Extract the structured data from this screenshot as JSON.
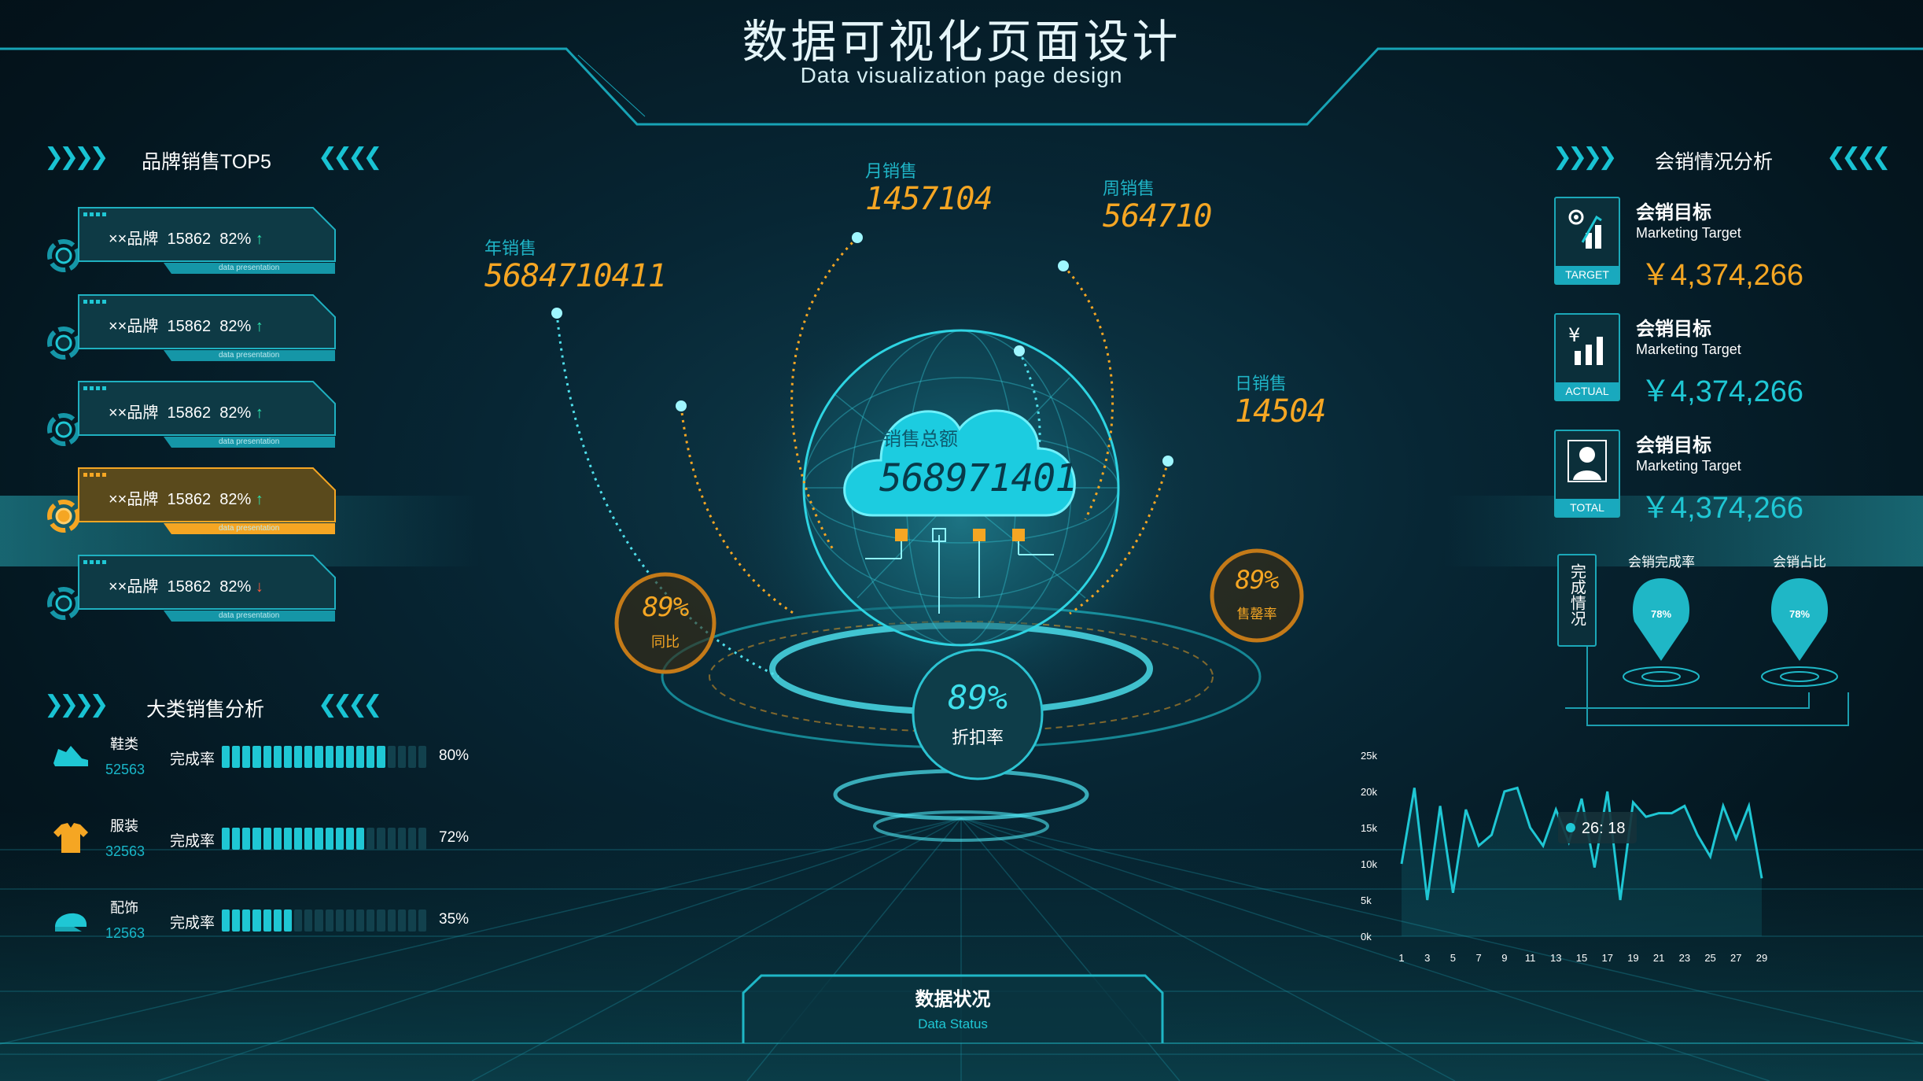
{
  "header": {
    "title": "数据可视化页面设计",
    "subtitle": "Data visualization page design"
  },
  "brand_panel": {
    "title": "品牌销售TOP5",
    "items": [
      {
        "name": "××品牌",
        "value": "15862",
        "pct": "82%",
        "trend": "↑",
        "sub": "data presentation"
      },
      {
        "name": "××品牌",
        "value": "15862",
        "pct": "82%",
        "trend": "↑",
        "sub": "data presentation"
      },
      {
        "name": "××品牌",
        "value": "15862",
        "pct": "82%",
        "trend": "↑",
        "sub": "data presentation"
      },
      {
        "name": "××品牌",
        "value": "15862",
        "pct": "82%",
        "trend": "↑",
        "sub": "data presentation"
      },
      {
        "name": "××品牌",
        "value": "15862",
        "pct": "82%",
        "trend": "↓",
        "sub": "data presentation"
      }
    ]
  },
  "category_panel": {
    "title": "大类销售分析",
    "items": [
      {
        "name": "鞋类",
        "value": "52563",
        "label": "完成率",
        "pct": "80%",
        "fraction": 0.8,
        "icon": "shoe-icon"
      },
      {
        "name": "服装",
        "value": "32563",
        "label": "完成率",
        "pct": "72%",
        "fraction": 0.72,
        "icon": "shirt-icon"
      },
      {
        "name": "配饰",
        "value": "12563",
        "label": "完成率",
        "pct": "35%",
        "fraction": 0.35,
        "icon": "cap-icon"
      }
    ]
  },
  "center": {
    "year_label": "年销售",
    "year_value": "5684710411",
    "month_label": "月销售",
    "month_value": "1457104",
    "week_label": "周销售",
    "week_value": "564710",
    "day_label": "日销售",
    "day_value": "14504",
    "total_label": "销售总额",
    "total_value": "568971401",
    "yoy_value": "89%",
    "yoy_label": "同比",
    "sellthrough_value": "89%",
    "sellthrough_label": "售罄率",
    "discount_value": "89%",
    "discount_label": "折扣率",
    "bottom_title": "数据状况",
    "bottom_sub": "Data Status"
  },
  "sales_panel": {
    "title": "会销情况分析",
    "targets": [
      {
        "title": "会销目标",
        "en": "Marketing Target",
        "value": "￥4,374,266",
        "badge": "TARGET",
        "color": "#f5a623",
        "icon": "target-chart-icon"
      },
      {
        "title": "会销目标",
        "en": "Marketing Target",
        "value": "￥4,374,266",
        "badge": "ACTUAL",
        "color": "#1fc7d4",
        "icon": "yuan-chart-icon"
      },
      {
        "title": "会销目标",
        "en": "Marketing Target",
        "value": "￥4,374,266",
        "badge": "TOTAL",
        "color": "#1fc7d4",
        "icon": "user-icon"
      }
    ],
    "completion_vertical": "完成情况",
    "pins": [
      {
        "label": "会销完成率",
        "value": "78%"
      },
      {
        "label": "会销占比",
        "value": "78%"
      }
    ],
    "tooltip": "26: 18"
  },
  "chart_data": {
    "type": "line",
    "x": [
      1,
      2,
      3,
      4,
      5,
      6,
      7,
      8,
      9,
      10,
      11,
      12,
      13,
      14,
      15,
      16,
      17,
      18,
      19,
      20,
      21,
      22,
      23,
      24,
      25,
      26,
      27,
      28,
      29
    ],
    "x_ticks": [
      "1",
      "3",
      "5",
      "7",
      "9",
      "11",
      "13",
      "15",
      "17",
      "19",
      "21",
      "23",
      "25",
      "27",
      "29"
    ],
    "y_ticks": [
      "0k",
      "5k",
      "10k",
      "15k",
      "20k",
      "25k"
    ],
    "ylim": [
      0,
      25000
    ],
    "series": [
      {
        "values": [
          10000,
          20500,
          5000,
          18000,
          6000,
          17500,
          12500,
          14000,
          20000,
          20500,
          15000,
          12500,
          17500,
          13000,
          19000,
          9500,
          20000,
          5000,
          18500,
          16500,
          17000,
          17000,
          18000,
          14000,
          11000,
          18000,
          13500,
          18000,
          8000
        ]
      }
    ],
    "tooltip": {
      "x": 26,
      "label": "26: 18"
    },
    "color": "#1fc7d4"
  }
}
